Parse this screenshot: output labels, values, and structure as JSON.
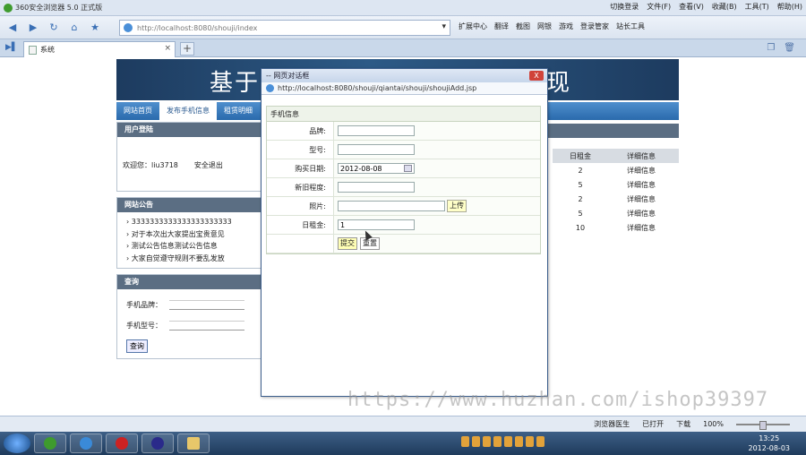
{
  "browser": {
    "title": "360安全浏览器 5.0 正式版",
    "menus": [
      "切换登录",
      "文件(F)",
      "查看(V)",
      "收藏(B)",
      "工具(T)",
      "帮助(H)"
    ],
    "address_url": "http://localhost:8080/shouji/index",
    "toolbar_right": [
      "扩展中心",
      "翻译",
      "截图",
      "网银",
      "游戏",
      "登录管家",
      "站长工具"
    ],
    "tab_title": "系统"
  },
  "page": {
    "banner_left": "基于",
    "banner_right": "现",
    "nav": [
      "网站首页",
      "发布手机信息",
      "租赁明细"
    ],
    "login": {
      "title": "用户登陆",
      "welcome": "欢迎您：liu3718",
      "logout": "安全退出"
    },
    "notice": {
      "title": "网站公告",
      "items": [
        "3333333333333333333333",
        "对于本次出大家提出宝贵意见",
        "测试公告信息测试公告信息",
        "大家自觉遵守规则不要乱发放"
      ]
    },
    "search": {
      "title": "查询",
      "brand_label": "手机品牌：",
      "model_label": "手机型号：",
      "button": "查询"
    },
    "right_table": {
      "header_rent": "日租金",
      "header_detail": "详细信息",
      "rows": [
        {
          "rent": "2",
          "detail": "详细信息"
        },
        {
          "rent": "5",
          "detail": "详细信息"
        },
        {
          "rent": "2",
          "detail": "详细信息"
        },
        {
          "rent": "5",
          "detail": "详细信息"
        },
        {
          "rent": "10",
          "detail": "详细信息"
        }
      ]
    }
  },
  "dialog": {
    "title": "-- 网页对话框",
    "close": "X",
    "url": "http://localhost:8080/shouji/qiantai/shouji/shoujiAdd.jsp",
    "form_title": "手机信息",
    "fields": {
      "brand_label": "品牌:",
      "model_label": "型号:",
      "date_label": "购买日期:",
      "date_value": "2012-08-08",
      "condition_label": "新旧程度:",
      "photo_label": "照片:",
      "upload": "上传",
      "rent_label": "日租金:",
      "rent_value": "1"
    },
    "submit": "提交",
    "reset": "重置"
  },
  "watermark": "https://www.huzhan.com/ishop39397",
  "statusbar": {
    "repair": "浏览器医生",
    "downloads": "下载",
    "zoom": "100%",
    "open": "已打开"
  },
  "taskbar": {
    "time": "13:25",
    "date": "2012-08-03"
  }
}
